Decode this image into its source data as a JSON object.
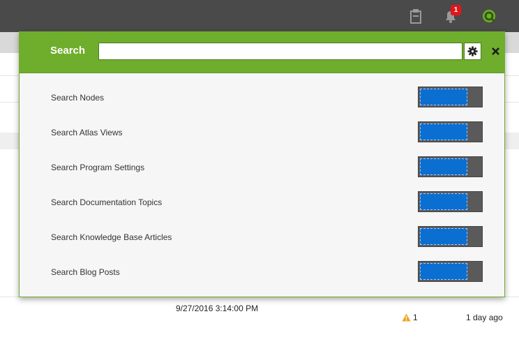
{
  "topbar": {
    "clipboard_icon": "clipboard-icon",
    "bell_icon": "bell-icon",
    "notification_count": "1",
    "avatar_icon": "user-avatar-icon",
    "brand_color": "#6fae2c"
  },
  "search": {
    "label": "Search",
    "value": "",
    "placeholder": "",
    "settings_icon": "gear-icon",
    "close_icon": "close-icon"
  },
  "options": [
    {
      "label": "Search Nodes",
      "enabled": true
    },
    {
      "label": "Search Atlas Views",
      "enabled": true
    },
    {
      "label": "Search Program Settings",
      "enabled": true
    },
    {
      "label": "Search Documentation Topics",
      "enabled": true
    },
    {
      "label": "Search Knowledge Base Articles",
      "enabled": true
    },
    {
      "label": "Search Blog Posts",
      "enabled": true
    }
  ],
  "background_row": {
    "timestamp": "9/27/2016 3:14:00 PM",
    "warning_count": "1",
    "age": "1 day ago"
  },
  "colors": {
    "toggle_on": "#0a6fd1",
    "toggle_track": "#5a5a5a",
    "panel_header": "#6fae2c",
    "warning": "#f0a21e"
  }
}
